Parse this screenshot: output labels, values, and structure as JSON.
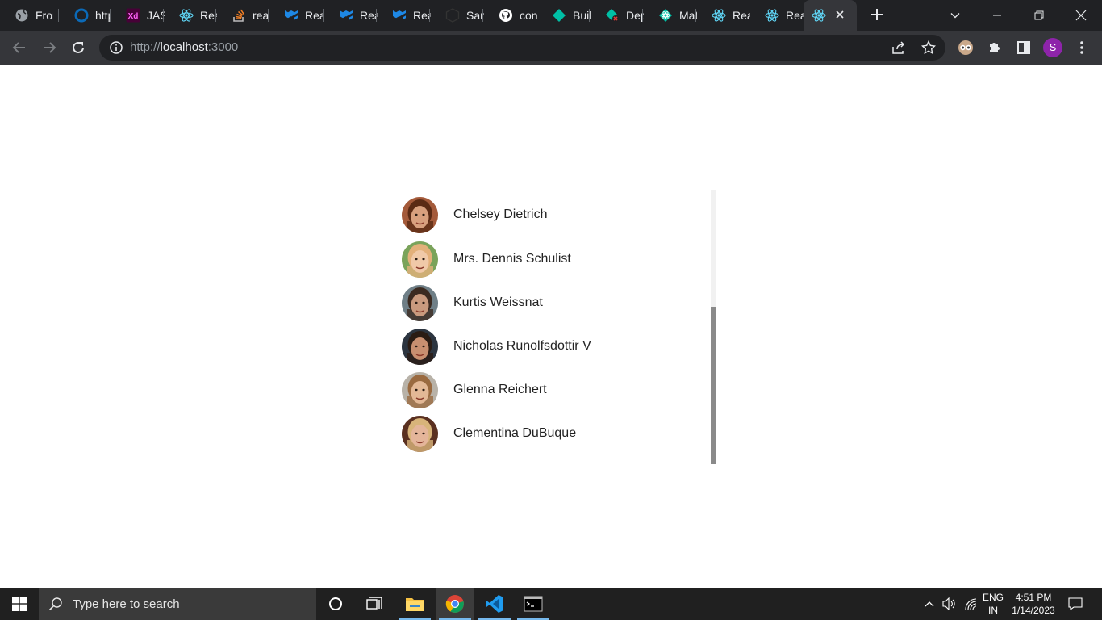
{
  "browser": {
    "tabs": [
      {
        "title": "Fron",
        "icon": "globe-icon"
      },
      {
        "title": "http",
        "icon": "ring-icon"
      },
      {
        "title": "JAS",
        "icon": "adobe-xd-icon"
      },
      {
        "title": "Rea",
        "icon": "react-icon"
      },
      {
        "title": "rea",
        "icon": "stackoverflow-icon"
      },
      {
        "title": "Rea",
        "icon": "mui-icon"
      },
      {
        "title": "Rea",
        "icon": "mui-icon"
      },
      {
        "title": "Rea",
        "icon": "mui-icon"
      },
      {
        "title": "San",
        "icon": "codesandbox-icon"
      },
      {
        "title": "con",
        "icon": "github-icon"
      },
      {
        "title": "Buil",
        "icon": "diamond-icon"
      },
      {
        "title": "Dep",
        "icon": "diamond-error-icon"
      },
      {
        "title": "Mat",
        "icon": "react-diamond-icon"
      },
      {
        "title": "Rea",
        "icon": "react-icon"
      },
      {
        "title": "Rea",
        "icon": "react-icon"
      },
      {
        "title": "",
        "icon": "react-icon"
      }
    ],
    "url_scheme": "http://",
    "url_host": "localhost",
    "url_port": ":3000",
    "profile_initial": "S"
  },
  "user_list": [
    {
      "name": "Chelsey Dietrich",
      "skin": "#d8a07e",
      "hair": "#5a2a14",
      "bg": "#a45a3a"
    },
    {
      "name": "Mrs. Dennis Schulist",
      "skin": "#f0c9a8",
      "hair": "#e3b07a",
      "bg": "#7aa35a"
    },
    {
      "name": "Kurtis Weissnat",
      "skin": "#c99a7e",
      "hair": "#3b2a20",
      "bg": "#6f7f87"
    },
    {
      "name": "Nicholas Runolfsdottir V",
      "skin": "#c88f70",
      "hair": "#2a1c14",
      "bg": "#2c3540"
    },
    {
      "name": "Glenna Reichert",
      "skin": "#e3b896",
      "hair": "#9a6a40",
      "bg": "#b8b2a8"
    },
    {
      "name": "Clementina DuBuque",
      "skin": "#e4b59a",
      "hair": "#d8b47a",
      "bg": "#5a3020"
    }
  ],
  "taskbar": {
    "search_placeholder": "Type here to search",
    "language_top": "ENG",
    "language_bottom": "IN",
    "time": "4:51 PM",
    "date": "1/14/2023"
  }
}
